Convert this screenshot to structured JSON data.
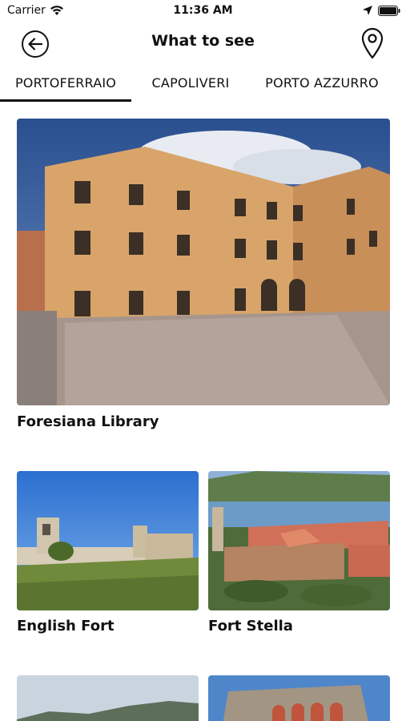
{
  "status_bar": {
    "carrier": "Carrier",
    "time": "11:36 AM"
  },
  "nav": {
    "title": "What to see",
    "back_icon": "back-arrow-circle-icon",
    "map_icon": "map-pin-icon"
  },
  "tabs": [
    {
      "label": "PORTOFERRAIO",
      "selected": true
    },
    {
      "label": "CAPOLIVERI",
      "selected": false
    },
    {
      "label": "PORTO AZZURRO",
      "selected": false
    }
  ],
  "places": [
    {
      "name": "Foresiana Library"
    },
    {
      "name": "English Fort"
    },
    {
      "name": "Fort Stella"
    },
    {
      "name": ""
    },
    {
      "name": ""
    }
  ]
}
